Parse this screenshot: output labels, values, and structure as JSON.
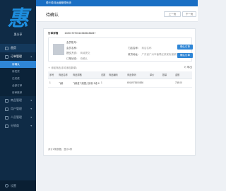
{
  "app": {
    "topbar_title": "德卡希特运营管理系统",
    "logo_text": "惠分享"
  },
  "sidebar": {
    "items": [
      {
        "label": "首页",
        "expanded": false
      },
      {
        "label": "订单管理",
        "expanded": true
      },
      {
        "label": "商品管理",
        "expanded": false
      },
      {
        "label": "用户管理",
        "expanded": false
      },
      {
        "label": "人员管理",
        "expanded": false
      },
      {
        "label": "分销商",
        "expanded": false
      }
    ],
    "subitems": [
      "待确认",
      "待发货",
      "已完成",
      "全部订单",
      "待审核单"
    ],
    "footer_label": "设置"
  },
  "header": {
    "title": "待确认",
    "prev_label": "上一页",
    "next_label": "下一页"
  },
  "order": {
    "label": "订单详情",
    "number": "1020170703123465436847"
  },
  "info_left": [
    {
      "label": "会员账号：",
      "value": ""
    },
    {
      "label": "会员名称：",
      "value": ""
    },
    {
      "label": "提交方式：",
      "value": "商城提交"
    },
    {
      "label": "订单状态：",
      "value": "待确认"
    }
  ],
  "info_right": [
    {
      "label": "门店名称：",
      "value": "商店名称"
    },
    {
      "label": "收货地址：",
      "value": "广东省广州市番禺区某某街道某某小区某某号"
    }
  ],
  "confirm_label_1": "确认订单",
  "confirm_label_2": "确认订单",
  "add_product_label": "添加商品(手动添加新单)",
  "export_label": "导出",
  "table": {
    "headers": [
      "序号",
      "商品名称",
      "商品规格",
      "总数",
      "商品编码",
      "商品条码",
      "单价",
      "数量",
      "金额"
    ],
    "rows": [
      [
        "1",
        "飞鹤",
        "飞鹤星飞帆婴儿奶粉 3段 900g",
        "1",
        "",
        "6914973600836",
        "",
        "",
        "738.00"
      ]
    ]
  },
  "footer_note": "共计1条数据，显示1条"
}
